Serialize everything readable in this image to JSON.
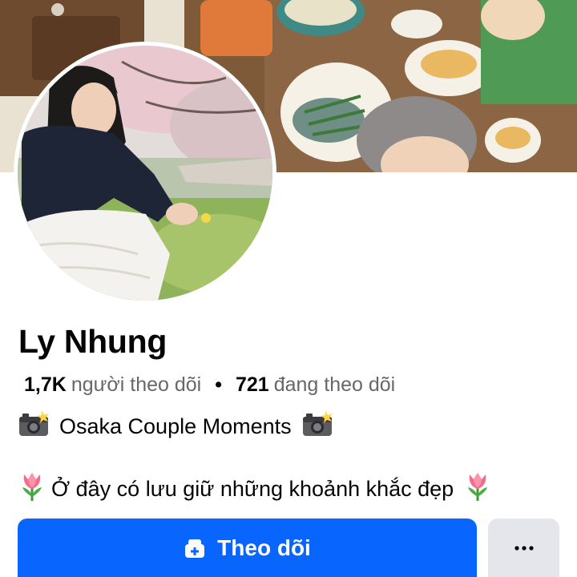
{
  "profile": {
    "name": "Ly Nhung",
    "followers_count": "1,7K",
    "followers_label": "người theo dõi",
    "separator": "•",
    "following_count": "721",
    "following_label": "đang theo dõi",
    "bio_line1": "Osaka Couple Moments",
    "bio_line2": "Ở đây có lưu giữ những khoảnh khắc đẹp"
  },
  "actions": {
    "follow_label": "Theo dõi",
    "more_label": "•••"
  },
  "icons": {
    "bio_line1_left": "camera-flash-icon",
    "bio_line1_right": "camera-flash-icon",
    "bio_line2_left": "tulip-icon",
    "bio_line2_right": "tulip-icon",
    "follow": "add-friend-icon"
  },
  "colors": {
    "primary_button": "#0866ff",
    "secondary_button": "#e4e6eb",
    "secondary_text": "#65676b"
  }
}
